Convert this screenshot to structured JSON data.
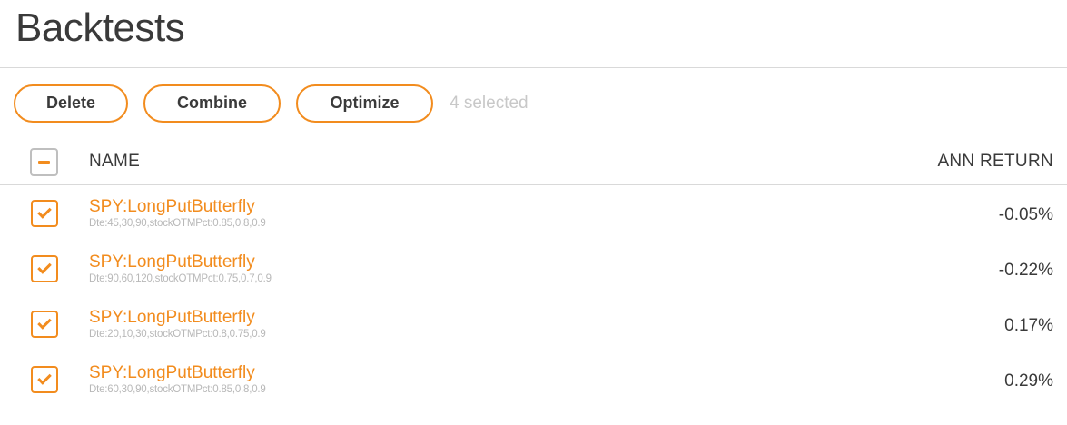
{
  "page": {
    "title": "Backtests"
  },
  "toolbar": {
    "delete_label": "Delete",
    "combine_label": "Combine",
    "optimize_label": "Optimize",
    "selected_text": "4 selected"
  },
  "table": {
    "headers": {
      "name": "NAME",
      "return": "ANN RETURN"
    },
    "header_checkbox_state": "indeterminate",
    "rows": [
      {
        "checked": true,
        "name": "SPY:LongPutButterfly",
        "params": "Dte:45,30,90,stockOTMPct:0.85,0.8,0.9",
        "return": "-0.05%"
      },
      {
        "checked": true,
        "name": "SPY:LongPutButterfly",
        "params": "Dte:90,60,120,stockOTMPct:0.75,0.7,0.9",
        "return": "-0.22%"
      },
      {
        "checked": true,
        "name": "SPY:LongPutButterfly",
        "params": "Dte:20,10,30,stockOTMPct:0.8,0.75,0.9",
        "return": "0.17%"
      },
      {
        "checked": true,
        "name": "SPY:LongPutButterfly",
        "params": "Dte:60,30,90,stockOTMPct:0.85,0.8,0.9",
        "return": "0.29%"
      }
    ]
  },
  "colors": {
    "accent": "#f28c1e",
    "text": "#3a3a3a",
    "muted": "#b8b8b8",
    "divider": "#d9d9d9"
  }
}
